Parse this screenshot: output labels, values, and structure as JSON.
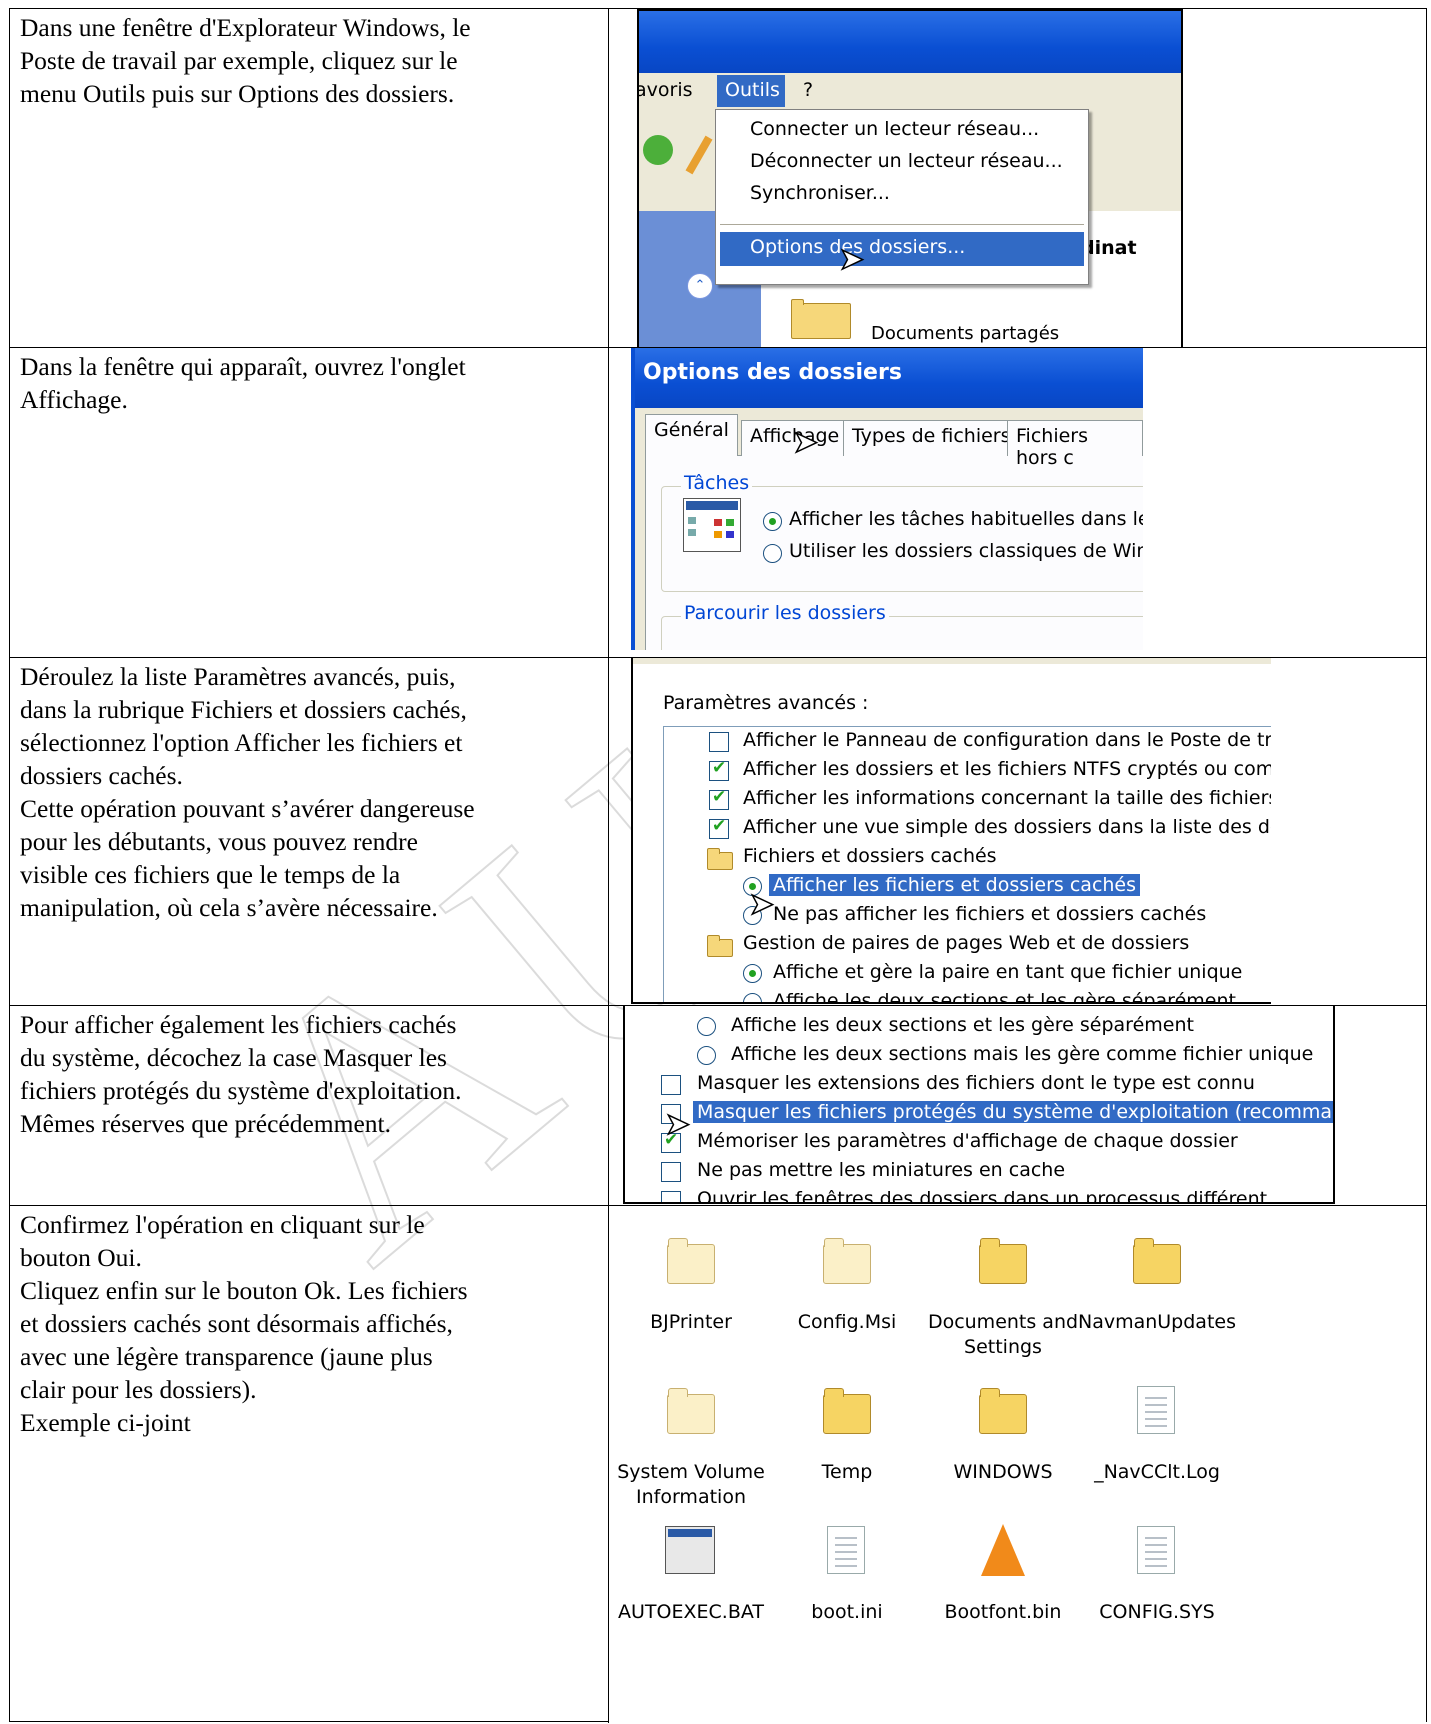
{
  "rows": [
    {
      "text": "Dans une fenêtre d'Explorateur Windows, le\nPoste de travail par exemple, cliquez sur le\nmenu Outils puis sur Options des dossiers."
    },
    {
      "text": "Dans la fenêtre qui apparaît, ouvrez l'onglet\nAffichage."
    },
    {
      "text": "Déroulez la liste Paramètres avancés, puis,\ndans la rubrique Fichiers et dossiers cachés,\nsélectionnez l'option Afficher les fichiers et\ndossiers cachés.\nCette opération pouvant s’avérer dangereuse\npour les débutants, vous pouvez rendre\nvisible ces fichiers que le temps de la\nmanipulation, où cela s’avère nécessaire."
    },
    {
      "text": "Pour afficher également les fichiers cachés\ndu système, décochez la case Masquer les\nfichiers protégés du système d'exploitation.\nMêmes réserves que précédemment."
    },
    {
      "text": "Confirmez l'opération en cliquant sur le\nbouton Oui.\nCliquez enfin sur le bouton Ok. Les fichiers\net dossiers cachés sont désormais affichés,\navec une légère transparence (jaune plus\nclair pour les dossiers).\nExemple ci-joint"
    }
  ],
  "screen1": {
    "menubar": {
      "favoris": "avoris",
      "outils": "Outils",
      "help": "?"
    },
    "menu_items": [
      "Connecter un lecteur réseau...",
      "Déconnecter un lecteur réseau...",
      "Synchroniser...",
      "Options des dossiers..."
    ],
    "pane_title_fragment": "dinat",
    "folder_label_fragment": "Documents partagés"
  },
  "screen2": {
    "title": "Options des dossiers",
    "tabs": [
      "Général",
      "Affichage",
      "Types de fichiers",
      "Fichiers hors c"
    ],
    "group1_label": "Tâches",
    "group1_options": [
      "Afficher les tâches habituelles dans les d",
      "Utiliser les dossiers classiques de Windo"
    ],
    "group2_label": "Parcourir les dossiers"
  },
  "screen3": {
    "header": "Paramètres avancés :",
    "items": [
      "Afficher le Panneau de configuration dans le Poste de travail",
      "Afficher les dossiers et les fichiers NTFS cryptés ou compress",
      "Afficher les informations concernant la taille des fichiers dans l",
      "Afficher une vue simple des dossiers dans la liste des dossiers",
      "Fichiers et dossiers cachés",
      "Afficher les fichiers et dossiers cachés",
      "Ne pas afficher les fichiers et dossiers cachés",
      "Gestion de paires de pages Web et de dossiers",
      "Affiche et gère la paire en tant que fichier unique",
      "Affiche les deux sections et les gère séparément"
    ]
  },
  "screen4": {
    "items": [
      "Affiche les deux sections et les gère séparément",
      "Affiche les deux sections mais les gère comme fichier unique",
      "Masquer les extensions des fichiers dont le type est connu",
      "Masquer les fichiers protégés du système d'exploitation (recommandé)",
      "Mémoriser les paramètres d'affichage de chaque dossier",
      "Ne pas mettre les miniatures en cache",
      "Ouvrir les fenêtres des dossiers dans un processus différent"
    ]
  },
  "screen5": {
    "icons": [
      {
        "label": "BJPrinter",
        "kind": "folder-light"
      },
      {
        "label": "Config.Msi",
        "kind": "folder-light"
      },
      {
        "label": "Documents and\nSettings",
        "kind": "folder"
      },
      {
        "label": "NavmanUpdates",
        "kind": "folder"
      },
      {
        "label": "System Volume\nInformation",
        "kind": "folder-light"
      },
      {
        "label": "Temp",
        "kind": "folder"
      },
      {
        "label": "WINDOWS",
        "kind": "folder"
      },
      {
        "label": "_NavCClt.Log",
        "kind": "text-file"
      },
      {
        "label": "AUTOEXEC.BAT",
        "kind": "batch-file"
      },
      {
        "label": "boot.ini",
        "kind": "ini-file"
      },
      {
        "label": "Bootfont.bin",
        "kind": "vlc-file"
      },
      {
        "label": "CONFIG.SYS",
        "kind": "sys-file"
      }
    ]
  },
  "watermark": "AU"
}
